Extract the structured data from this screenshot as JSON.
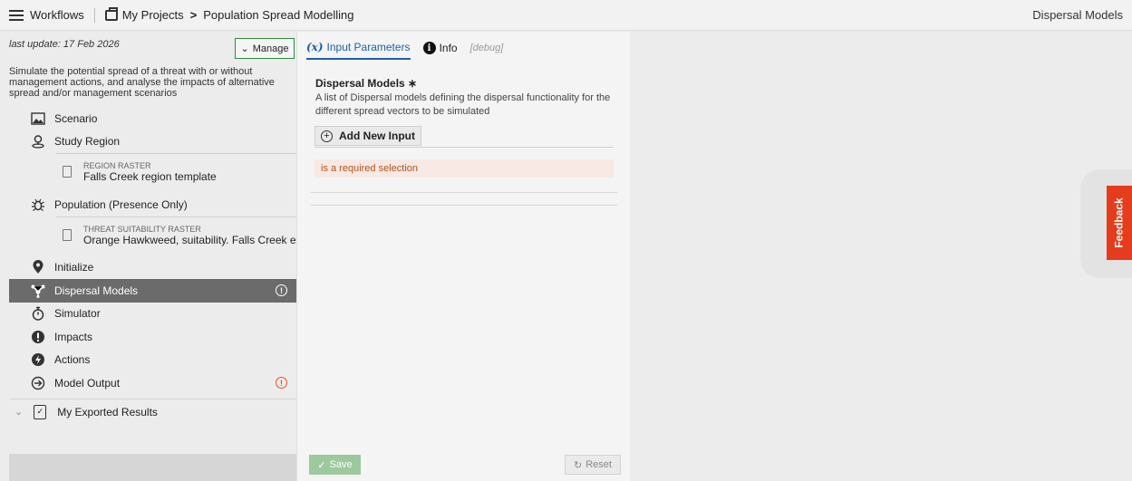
{
  "topbar": {
    "workflows_label": "Workflows",
    "projects_label": "My Projects",
    "breadcrumb_sep": ">",
    "project_name": "Population Spread Modelling",
    "current_view": "Dispersal Models"
  },
  "sidebar": {
    "last_update": "last update: 17 Feb 2026",
    "manage_label": "Manage",
    "description": "Simulate the potential spread of a threat with or without management actions, and analyse the impacts of alternative spread and/or management scenarios",
    "items": [
      {
        "label": "Scenario",
        "icon": "image-icon"
      },
      {
        "label": "Study Region",
        "icon": "map-pin-icon"
      },
      {
        "label": "Population (Presence Only)",
        "icon": "bug-icon"
      },
      {
        "label": "Initialize",
        "icon": "location-pin-icon"
      },
      {
        "label": "Dispersal Models",
        "icon": "dispersal-icon",
        "active": true,
        "warning": "!"
      },
      {
        "label": "Simulator",
        "icon": "stopwatch-icon"
      },
      {
        "label": "Impacts",
        "icon": "exclamation-icon"
      },
      {
        "label": "Actions",
        "icon": "lightning-icon"
      },
      {
        "label": "Model Output",
        "icon": "arrow-circle-icon",
        "warning": "!"
      }
    ],
    "region_raster": {
      "label": "REGION RASTER",
      "value": "Falls Creek region template"
    },
    "threat_raster": {
      "label": "THREAT SUITABILITY RASTER",
      "value": "Orange Hawkweed, suitability. Falls Creek example"
    },
    "exported_results": "My Exported Results"
  },
  "panel": {
    "tabs": {
      "input_icon": "(x)",
      "input_label": "Input Parameters",
      "info_icon": "i",
      "info_label": "Info",
      "debug_label": "[debug]"
    },
    "field_title": "Dispersal Models ∗",
    "field_description": "A list of Dispersal models defining the dispersal functionality for the different spread vectors to be simulated",
    "add_label": "Add New Input",
    "error_text": "is a required selection",
    "save_label": "Save",
    "reset_label": "Reset"
  },
  "feedback_label": "Feedback",
  "colors": {
    "accent_blue": "#1d5fad",
    "active_nav": "#6b6b6b",
    "warning_orange": "#e8541c",
    "save_green": "#9dc99e",
    "feedback_red": "#e43c1c",
    "error_bg": "#f8e9e4"
  }
}
